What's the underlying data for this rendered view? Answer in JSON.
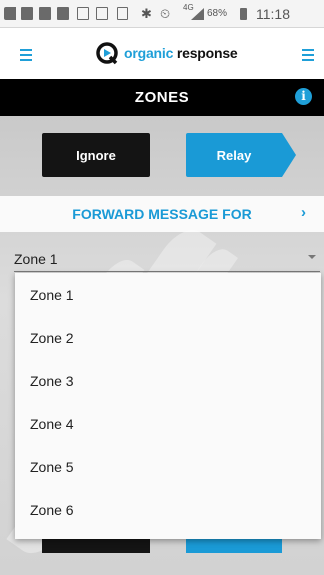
{
  "status_bar": {
    "network": "4G",
    "battery": "68%",
    "time": "11:18"
  },
  "header": {
    "logo_part1": "organic",
    "logo_part2": " response"
  },
  "title_bar": {
    "title": "ZONES",
    "info_glyph": "i"
  },
  "mode_buttons": {
    "ignore": "Ignore",
    "relay": "Relay"
  },
  "forward": {
    "label": "FORWARD MESSAGE FOR",
    "chevron": "›"
  },
  "zone_select": {
    "selected": "Zone 1",
    "options": [
      "Zone 1",
      "Zone 2",
      "Zone 3",
      "Zone 4",
      "Zone 5",
      "Zone 6"
    ]
  },
  "colors": {
    "accent": "#1a9ad6",
    "dark": "#141414"
  }
}
